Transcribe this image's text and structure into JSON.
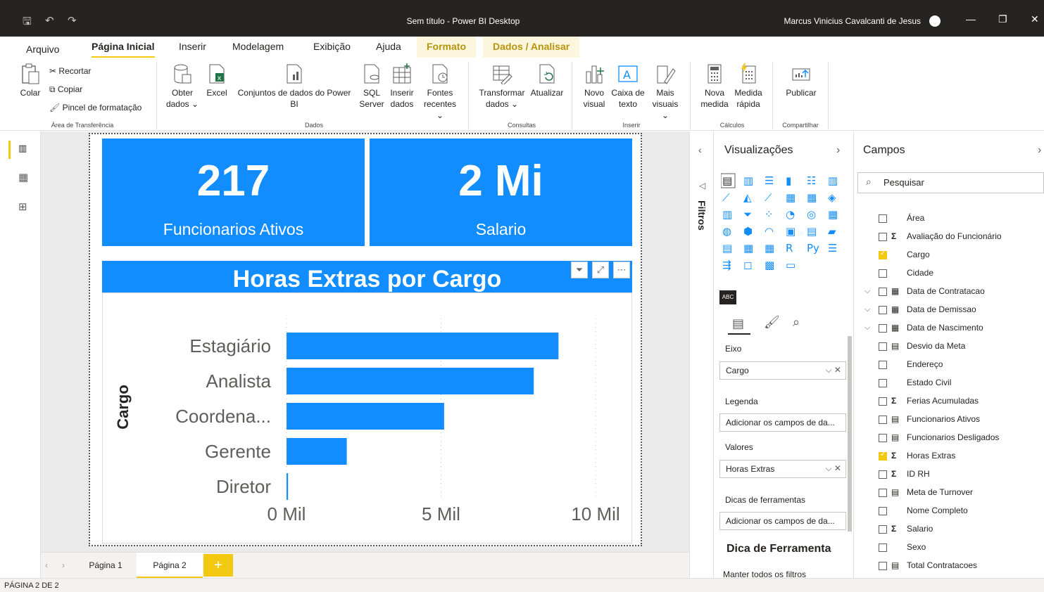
{
  "window": {
    "title": "Sem título - Power BI Desktop",
    "user": "Marcus Vinicius Cavalcanti de Jesus"
  },
  "ribbon_tabs": [
    "Arquivo",
    "Página Inicial",
    "Inserir",
    "Modelagem",
    "Exibição",
    "Ajuda",
    "Formato",
    "Dados / Analisar"
  ],
  "ribbon": {
    "clipboard": {
      "paste": "Colar",
      "cut": "Recortar",
      "copy": "Copiar",
      "format_painter": "Pincel de formatação",
      "group": "Área de Transferência"
    },
    "data": {
      "get_data_1": "Obter",
      "get_data_2": "dados ⌄",
      "excel": "Excel",
      "datasets_1": "Conjuntos de dados do Power",
      "datasets_2": "BI",
      "sql_1": "SQL",
      "sql_2": "Server",
      "insert_data_1": "Inserir",
      "insert_data_2": "dados",
      "recent_1": "Fontes",
      "recent_2": "recentes ⌄",
      "group": "Dados"
    },
    "queries": {
      "transform_1": "Transformar",
      "transform_2": "dados ⌄",
      "refresh": "Atualizar",
      "group": "Consultas"
    },
    "insert": {
      "new_visual_1": "Novo",
      "new_visual_2": "visual",
      "textbox_1": "Caixa de",
      "textbox_2": "texto",
      "more_1": "Mais",
      "more_2": "visuais ⌄",
      "group": "Inserir"
    },
    "calc": {
      "new_measure_1": "Nova",
      "new_measure_2": "medida",
      "quick_measure_1": "Medida",
      "quick_measure_2": "rápida",
      "group": "Cálculos"
    },
    "share": {
      "publish": "Publicar",
      "group": "Compartilhar"
    }
  },
  "cards": [
    {
      "value": "217",
      "label": "Funcionarios Ativos"
    },
    {
      "value": "2 Mi",
      "label": "Salario"
    }
  ],
  "chart_data": {
    "type": "bar",
    "orientation": "horizontal",
    "title": "Horas Extras por Cargo",
    "ylabel": "Cargo",
    "categories": [
      "Estagiário",
      "Analista",
      "Coordena...",
      "Gerente",
      "Diretor"
    ],
    "values": [
      8800,
      8000,
      5100,
      1950,
      50
    ],
    "xlim": [
      0,
      10000
    ],
    "xticks": [
      {
        "value": 0,
        "label": "0 Mil"
      },
      {
        "value": 5000,
        "label": "5 Mil"
      },
      {
        "value": 10000,
        "label": "10 Mil"
      }
    ],
    "color": "#118dff",
    "grid": "vertical dotted"
  },
  "page_tabs": [
    "Página 1",
    "Página 2"
  ],
  "add_page": "+",
  "status": "PÁGINA 2 DE 2",
  "filters_label": "Filtros",
  "visualizations": {
    "title": "Visualizações",
    "wells": [
      {
        "label": "Eixo",
        "value": "Cargo",
        "filled": true
      },
      {
        "label": "Legenda",
        "value": "Adicionar os campos de da...",
        "filled": false
      },
      {
        "label": "Valores",
        "value": "Horas Extras",
        "filled": true
      },
      {
        "label": "Dicas de ferramentas",
        "value": "Adicionar os campos de da...",
        "filled": false
      }
    ],
    "tooltip_section": "Dica de Ferramenta",
    "keep_filters": "Manter todos os filtros"
  },
  "fields": {
    "title": "Campos",
    "search_placeholder": "Pesquisar",
    "items": [
      {
        "name": "Área",
        "type": "",
        "checked": false,
        "expand": false
      },
      {
        "name": "Avaliação do Funcionário",
        "type": "Σ",
        "checked": false,
        "expand": false
      },
      {
        "name": "Cargo",
        "type": "",
        "checked": true,
        "expand": false
      },
      {
        "name": "Cidade",
        "type": "",
        "checked": false,
        "expand": false
      },
      {
        "name": "Data de Contratacao",
        "type": "▦",
        "checked": false,
        "expand": true
      },
      {
        "name": "Data de Demissao",
        "type": "▦",
        "checked": false,
        "expand": true
      },
      {
        "name": "Data de Nascimento",
        "type": "▦",
        "checked": false,
        "expand": true
      },
      {
        "name": "Desvio da Meta",
        "type": "▤",
        "checked": false,
        "expand": false
      },
      {
        "name": "Endereço",
        "type": "",
        "checked": false,
        "expand": false
      },
      {
        "name": "Estado Civil",
        "type": "",
        "checked": false,
        "expand": false
      },
      {
        "name": "Ferias Acumuladas",
        "type": "Σ",
        "checked": false,
        "expand": false
      },
      {
        "name": "Funcionarios Ativos",
        "type": "▤",
        "checked": false,
        "expand": false
      },
      {
        "name": "Funcionarios Desligados",
        "type": "▤",
        "checked": false,
        "expand": false
      },
      {
        "name": "Horas Extras",
        "type": "Σ",
        "checked": true,
        "expand": false
      },
      {
        "name": "ID RH",
        "type": "Σ",
        "checked": false,
        "expand": false
      },
      {
        "name": "Meta de Turnover",
        "type": "▤",
        "checked": false,
        "expand": false
      },
      {
        "name": "Nome Completo",
        "type": "",
        "checked": false,
        "expand": false
      },
      {
        "name": "Salario",
        "type": "Σ",
        "checked": false,
        "expand": false
      },
      {
        "name": "Sexo",
        "type": "",
        "checked": false,
        "expand": false
      },
      {
        "name": "Total Contratacoes",
        "type": "▤",
        "checked": false,
        "expand": false
      }
    ]
  }
}
